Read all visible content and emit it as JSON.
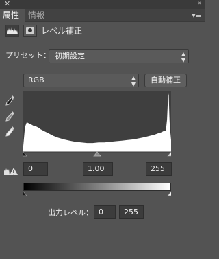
{
  "panel": {
    "tabs": [
      {
        "label": "属性"
      },
      {
        "label": "情報"
      }
    ],
    "title": "レベル補正",
    "menu_icon": "panel-menu-icon"
  },
  "preset": {
    "label": "プリセット：",
    "value": "初期設定"
  },
  "channel": {
    "value": "RGB",
    "auto_button": "自動補正"
  },
  "input_levels": {
    "black": "0",
    "gamma": "1.00",
    "white": "255"
  },
  "output_levels": {
    "label": "出力レベル：",
    "black": "0",
    "white": "255"
  },
  "colors": {
    "panel_bg": "#535353",
    "histogram_bg": "#3f3f3f",
    "histogram_fill": "#ffffff"
  },
  "chart_data": {
    "type": "area",
    "x_range": [
      0,
      255
    ],
    "y_range": [
      0,
      1
    ],
    "description_values_relative": true,
    "x": [
      0,
      3,
      6,
      10,
      14,
      18,
      22,
      26,
      30,
      36,
      44,
      52,
      60,
      70,
      80,
      90,
      100,
      110,
      120,
      130,
      140,
      150,
      160,
      170,
      180,
      190,
      200,
      210,
      218,
      226,
      232,
      238,
      242,
      246,
      248,
      250,
      251,
      252,
      253,
      254,
      255
    ],
    "y": [
      0.1,
      0.42,
      0.5,
      0.48,
      0.46,
      0.44,
      0.43,
      0.41,
      0.38,
      0.35,
      0.31,
      0.27,
      0.24,
      0.21,
      0.19,
      0.17,
      0.16,
      0.15,
      0.15,
      0.16,
      0.16,
      0.17,
      0.18,
      0.19,
      0.2,
      0.21,
      0.23,
      0.25,
      0.27,
      0.29,
      0.31,
      0.33,
      0.35,
      0.36,
      0.55,
      1.0,
      0.95,
      0.6,
      0.4,
      0.3,
      0.2
    ]
  }
}
